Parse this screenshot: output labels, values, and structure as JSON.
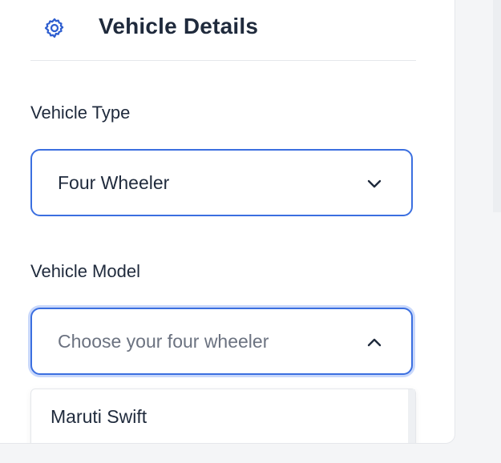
{
  "header": {
    "title": "Vehicle Details",
    "icon": "gear-icon"
  },
  "vehicle_type": {
    "label": "Vehicle Type",
    "value": "Four Wheeler"
  },
  "vehicle_model": {
    "label": "Vehicle Model",
    "placeholder": "Choose your four wheeler"
  },
  "dropdown": {
    "options": [
      {
        "label": "Maruti Swift"
      }
    ]
  },
  "colors": {
    "accent": "#3b6fe0",
    "text": "#1f2a3c",
    "placeholder": "#6b7280"
  }
}
